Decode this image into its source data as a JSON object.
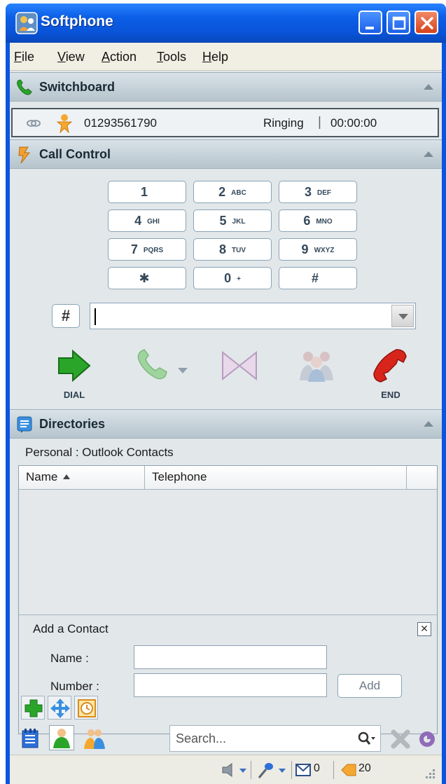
{
  "window": {
    "title": "Softphone"
  },
  "menu": {
    "file": "File",
    "view": "View",
    "action": "Action",
    "tools": "Tools",
    "help": "Help"
  },
  "switchboard": {
    "title": "Switchboard",
    "call": {
      "number": "01293561790",
      "status": "Ringing",
      "separator": "|",
      "duration": "00:00:00"
    }
  },
  "call_control": {
    "title": "Call Control",
    "keys": [
      {
        "num": "1",
        "sub": ""
      },
      {
        "num": "2",
        "sub": "ABC"
      },
      {
        "num": "3",
        "sub": "DEF"
      },
      {
        "num": "4",
        "sub": "GHI"
      },
      {
        "num": "5",
        "sub": "JKL"
      },
      {
        "num": "6",
        "sub": "MNO"
      },
      {
        "num": "7",
        "sub": "PQRS"
      },
      {
        "num": "8",
        "sub": "TUV"
      },
      {
        "num": "9",
        "sub": "WXYZ"
      },
      {
        "num": "✱",
        "sub": ""
      },
      {
        "num": "0",
        "sub": "+"
      },
      {
        "num": "#",
        "sub": ""
      }
    ],
    "hash_button": "#",
    "dial_value": "",
    "dial_label": "DIAL",
    "end_label": "END"
  },
  "directories": {
    "title": "Directories",
    "source": "Personal : Outlook Contacts",
    "columns": {
      "name": "Name",
      "telephone": "Telephone"
    },
    "rows": [],
    "add_contact": {
      "title": "Add a Contact",
      "close": "✕",
      "name_label": "Name :",
      "number_label": "Number :",
      "name_value": "",
      "number_value": "",
      "add_button": "Add"
    }
  },
  "search": {
    "placeholder": "Search..."
  },
  "status": {
    "mail_count": "0",
    "other_count": "20"
  },
  "colors": {
    "title_blue": "#0a55e0",
    "panel_bg": "#e2e7ea",
    "dial_green": "#2aa52a",
    "end_red": "#d8251c"
  }
}
